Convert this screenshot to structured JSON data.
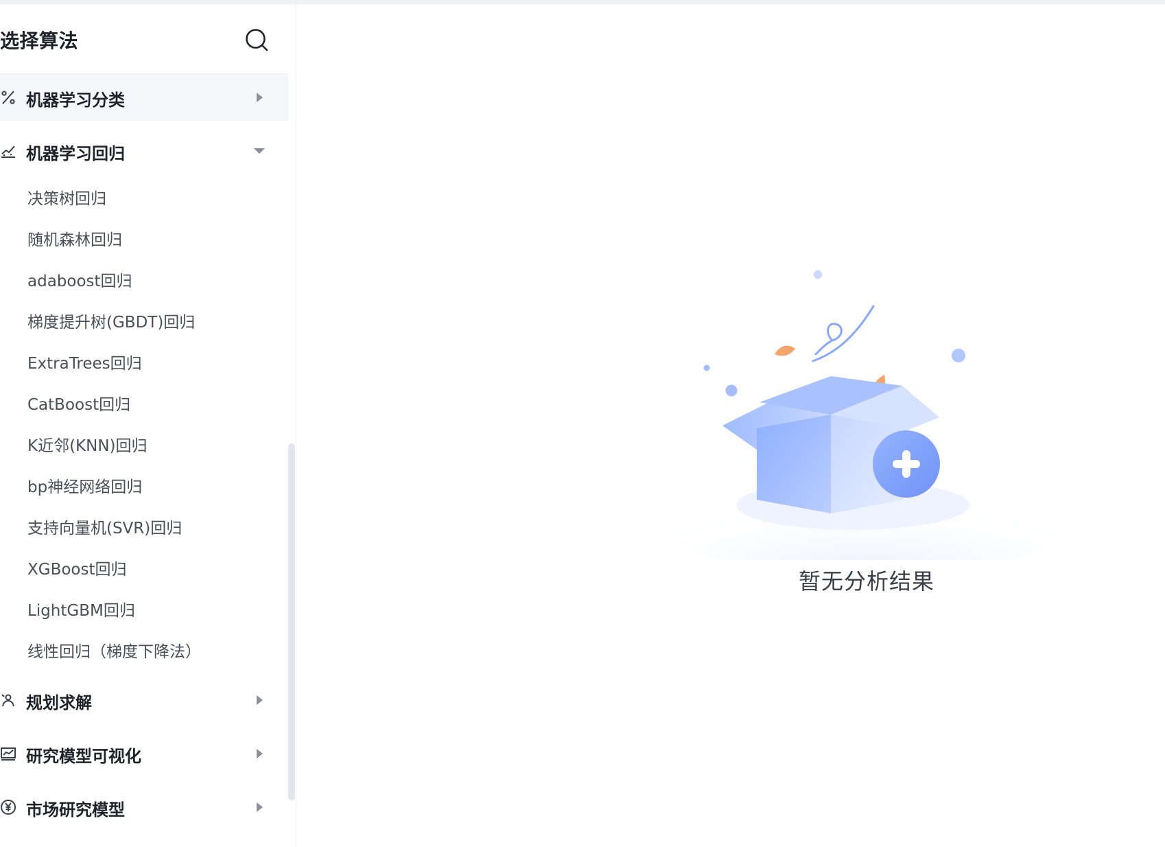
{
  "sidebar": {
    "title": "选择算法",
    "search_icon": "search-icon",
    "categories": [
      {
        "label": "机器学习分类",
        "icon": "percent-icon",
        "expanded": false
      },
      {
        "label": "机器学习回归",
        "icon": "regression-trend-icon",
        "expanded": true,
        "items": [
          "决策树回归",
          "随机森林回归",
          "adaboost回归",
          "梯度提升树(GBDT)回归",
          "ExtraTrees回归",
          "CatBoost回归",
          "K近邻(KNN)回归",
          "bp神经网络回归",
          "支持向量机(SVR)回归",
          "XGBoost回归",
          "LightGBM回归",
          "线性回归（梯度下降法）"
        ]
      },
      {
        "label": "规划求解",
        "icon": "planning-icon",
        "expanded": false
      },
      {
        "label": "研究模型可视化",
        "icon": "chart-visualization-icon",
        "expanded": false
      },
      {
        "label": "市场研究模型",
        "icon": "yen-coin-icon",
        "expanded": false
      }
    ]
  },
  "main": {
    "empty_state_text": "暂无分析结果",
    "empty_state_illustration": "empty-box-icon"
  },
  "colors": {
    "accent": "#6f93f5",
    "caret": "#8a8f98",
    "hover_bg": "#f5f7fb"
  }
}
